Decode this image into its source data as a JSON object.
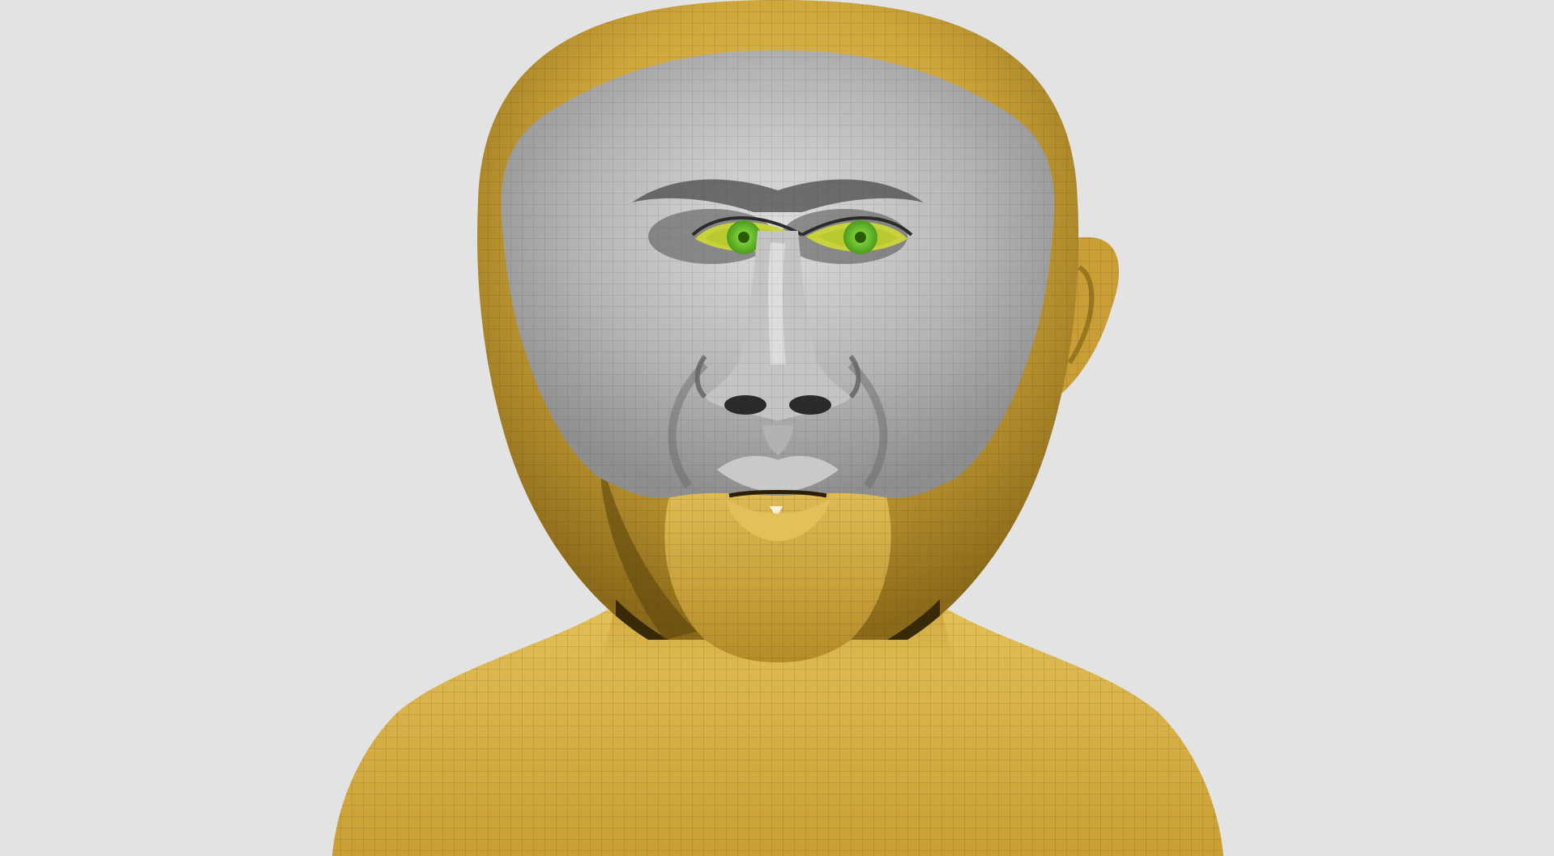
{
  "scene": {
    "background_color": "#e3e3e3",
    "subject": "head-bust-wireframe",
    "colors": {
      "skin_base": "#d2aa3c",
      "skin_light": "#e6c45a",
      "skin_shadow": "#8a6a18",
      "face_mask_light": "#d6d6d6",
      "face_mask_mid": "#a9a9a9",
      "face_mask_dark": "#5a5a5a",
      "iris": "#6fc02c",
      "eye_rim": "#c9d23a",
      "wire": "#3b3320"
    }
  }
}
